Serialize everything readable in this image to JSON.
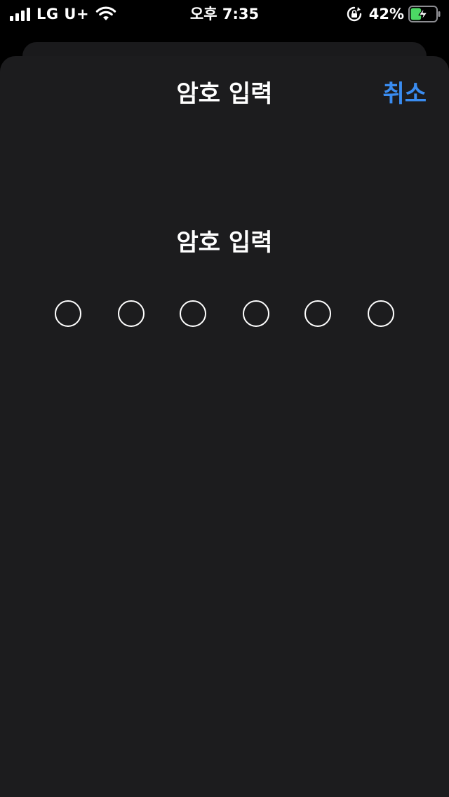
{
  "status_bar": {
    "carrier": "LG U+",
    "time": "오후 7:35",
    "battery_percent": "42%",
    "battery_level": 0.42,
    "charging": true,
    "icons": [
      "signal-icon",
      "wifi-icon",
      "lock-rotation-icon",
      "battery-icon"
    ]
  },
  "sheet": {
    "title": "암호 입력",
    "cancel_label": "취소",
    "prompt": "암호 입력",
    "passcode_length": 6,
    "digits_entered": 0
  },
  "colors": {
    "background": "#000000",
    "sheet": "#1c1c1e",
    "accent": "#3a8cf0",
    "battery_fill": "#4cd964"
  }
}
